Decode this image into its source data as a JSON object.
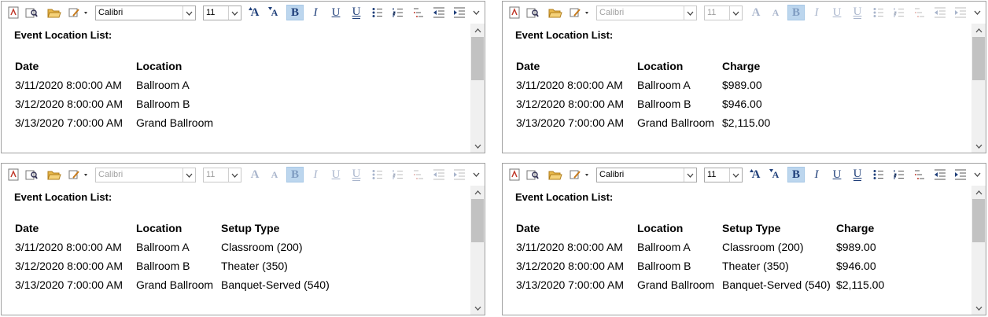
{
  "toolbar_enabled": {
    "font_name": "Calibri",
    "font_size": "11"
  },
  "toolbar_disabled": {
    "font_name": "Calibri",
    "font_size": "11"
  },
  "icons": [
    "insert-file-icon",
    "preview-icon",
    "open-folder-icon",
    "edit-dropdown-icon",
    "grow-font-icon",
    "shrink-font-icon",
    "bold-icon",
    "italic-icon",
    "underline-icon",
    "double-underline-icon",
    "bullets-icon",
    "numbering-icon",
    "multilevel-list-icon",
    "decrease-indent-icon",
    "increase-indent-icon",
    "more-chevron-icon"
  ],
  "toolbar_labels": {
    "bold": "B",
    "italic": "I",
    "underline": "U",
    "double_underline": "U",
    "grow": "A",
    "shrink": "A"
  },
  "panels": {
    "p1": {
      "title": "Event Location List:",
      "headers": [
        "Date",
        "Location"
      ],
      "rows": [
        [
          "3/11/2020 8:00:00 AM",
          "Ballroom A"
        ],
        [
          "3/12/2020 8:00:00 AM",
          "Ballroom B"
        ],
        [
          "3/13/2020 7:00:00 AM",
          "Grand Ballroom"
        ]
      ]
    },
    "p2": {
      "title": "Event Location List:",
      "headers": [
        "Date",
        "Location",
        "Charge"
      ],
      "rows": [
        [
          "3/11/2020 8:00:00 AM",
          "Ballroom A",
          "$989.00"
        ],
        [
          "3/12/2020 8:00:00 AM",
          "Ballroom B",
          "$946.00"
        ],
        [
          "3/13/2020 7:00:00 AM",
          "Grand Ballroom",
          "$2,115.00"
        ]
      ]
    },
    "p3": {
      "title": "Event Location List:",
      "headers": [
        "Date",
        "Location",
        "Setup Type"
      ],
      "rows": [
        [
          "3/11/2020 8:00:00 AM",
          "Ballroom A",
          "Classroom (200)"
        ],
        [
          "3/12/2020 8:00:00 AM",
          "Ballroom B",
          "Theater (350)"
        ],
        [
          "3/13/2020 7:00:00 AM",
          "Grand Ballroom",
          "Banquet-Served (540)"
        ]
      ]
    },
    "p4": {
      "title": "Event Location List:",
      "headers": [
        "Date",
        "Location",
        "Setup Type",
        "Charge"
      ],
      "rows": [
        [
          "3/11/2020 8:00:00 AM",
          "Ballroom A",
          "Classroom (200)",
          "$989.00"
        ],
        [
          "3/12/2020 8:00:00 AM",
          "Ballroom B",
          "Theater (350)",
          "$946.00"
        ],
        [
          "3/13/2020 7:00:00 AM",
          "Grand Ballroom",
          "Banquet-Served (540)",
          "$2,115.00"
        ]
      ]
    }
  },
  "colors": {
    "active_button": "#bcd6ee",
    "border": "#a0a0a0",
    "scroll_thumb": "#c2c2c2",
    "icon_blue": "#1f3f7a"
  }
}
